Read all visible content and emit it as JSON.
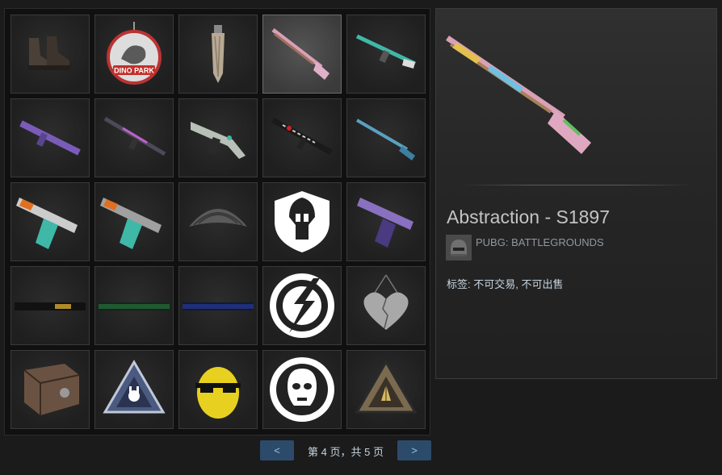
{
  "grid": {
    "items": [
      {
        "icon": "boots-icon"
      },
      {
        "icon": "dino-park-badge-icon",
        "text": "DINO PARK"
      },
      {
        "icon": "scarf-icon"
      },
      {
        "icon": "shotgun-icon",
        "selected": true
      },
      {
        "icon": "rifle-teal-icon"
      },
      {
        "icon": "smg-purple-icon"
      },
      {
        "icon": "rifle-purple-icon"
      },
      {
        "icon": "vector-smg-icon"
      },
      {
        "icon": "rifle-black-red-icon"
      },
      {
        "icon": "shotgun-blue-icon"
      },
      {
        "icon": "pistol-orange-icon"
      },
      {
        "icon": "pistol-orange-2-icon"
      },
      {
        "icon": "parachute-icon"
      },
      {
        "icon": "spartan-helmet-emblem-icon"
      },
      {
        "icon": "pistol-purple-icon"
      },
      {
        "icon": "banner-yellow-icon"
      },
      {
        "icon": "banner-green-icon"
      },
      {
        "icon": "banner-blue-icon"
      },
      {
        "icon": "lightning-emblem-icon"
      },
      {
        "icon": "heart-pendant-icon"
      },
      {
        "icon": "crate-icon"
      },
      {
        "icon": "triangle-bunny-icon"
      },
      {
        "icon": "lemon-sunglasses-icon"
      },
      {
        "icon": "luchador-emblem-icon"
      },
      {
        "icon": "triangle-gold-icon"
      }
    ]
  },
  "pager": {
    "prev_label": "<",
    "next_label": ">",
    "page_text": "第 4 页，共 5 页"
  },
  "detail": {
    "title": "Abstraction - S1897",
    "game_name": "PUBG: BATTLEGROUNDS",
    "tags": "标签: 不可交易, 不可出售",
    "item_icon": "shotgun-icon",
    "game_icon": "pubg-helmet-icon"
  },
  "colors": {
    "page_bg": "#1b1b1b",
    "slot_bg": "#262626",
    "slot_selected_bg": "#4a4a4a",
    "pager_button": "#2c4b6b",
    "pager_button_text": "#8fc3ec",
    "title_text": "#c4c4c4",
    "muted_text": "#8f98a0"
  }
}
